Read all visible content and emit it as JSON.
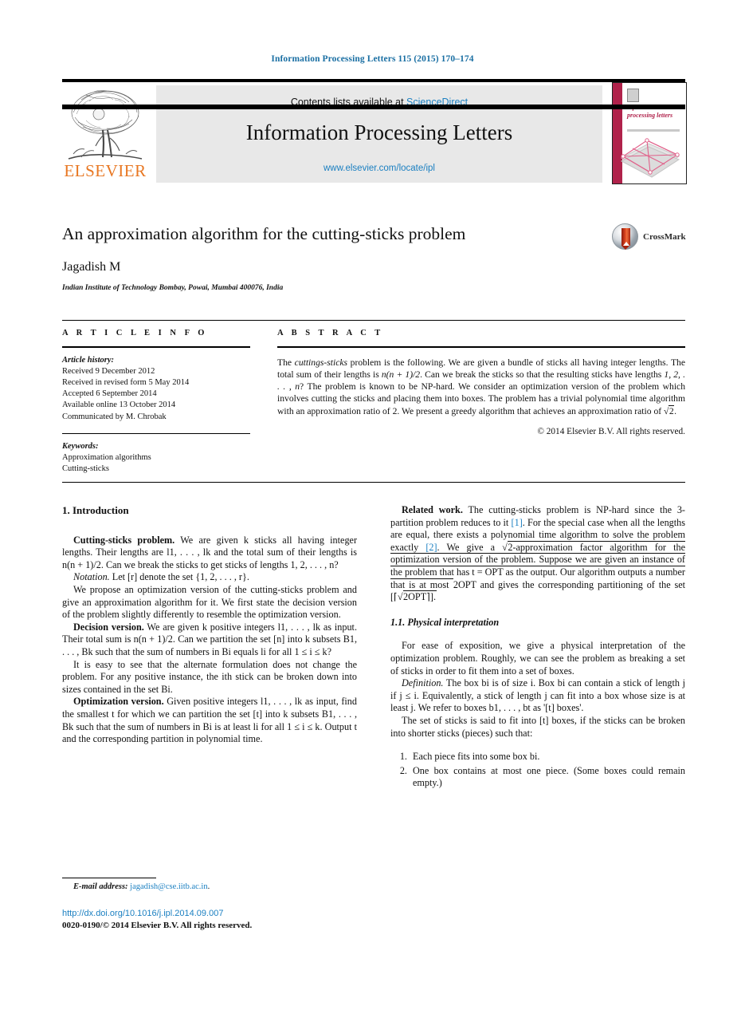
{
  "running_head": "Information Processing Letters 115 (2015) 170–174",
  "masthead": {
    "contents_prefix": "Contents lists available at ",
    "sciencedirect": "ScienceDirect",
    "journal_title": "Information Processing Letters",
    "journal_url": "www.elsevier.com/locate/ipl",
    "publisher_logo_text": "ELSEVIER",
    "cover_title": "information processing letters",
    "accent_color": "#1a7fc1",
    "elsevier_orange": "#E87722",
    "cover_spine_color": "#b0224b"
  },
  "title_block": {
    "title": "An approximation algorithm for the cutting-sticks problem",
    "author": "Jagadish M",
    "affiliation": "Indian Institute of Technology Bombay, Powai, Mumbai 400076, India",
    "crossmark_label": "CrossMark"
  },
  "article_info": {
    "heading": "A R T I C L E   I N F O",
    "history_label": "Article history:",
    "history": [
      "Received 9 December 2012",
      "Received in revised form 5 May 2014",
      "Accepted 6 September 2014",
      "Available online 13 October 2014",
      "Communicated by M. Chrobak"
    ],
    "keywords_label": "Keywords:",
    "keywords": [
      "Approximation algorithms",
      "Cutting-sticks"
    ]
  },
  "abstract": {
    "heading": "A B S T R A C T",
    "p1_a": "The ",
    "p1_italic": "cuttings-sticks",
    "p1_b": " problem is the following. We are given a bundle of sticks all having integer lengths. The total sum of their lengths is ",
    "p1_math1": "n(n + 1)/2",
    "p1_c": ". Can we break the sticks so that the resulting sticks have lengths ",
    "p1_math2": "1, 2, . . . , n",
    "p1_d": "? The problem is known to be NP-hard. We consider an optimization version of the problem which involves cutting the sticks and placing them into boxes. The problem has a trivial polynomial time algorithm with an approximation ratio of 2. We present a greedy algorithm that achieves an approximation ratio of ",
    "p1_math3": "2",
    "p1_e": ".",
    "copyright": "© 2014 Elsevier B.V. All rights reserved."
  },
  "left_column": {
    "section_heading": "1. Introduction",
    "p1_runin": "Cutting-sticks problem.",
    "p1_text": " We are given k sticks all having integer lengths. Their lengths are l1, . . . , lk and the total sum of their lengths is n(n + 1)/2. Can we break the sticks to get sticks of lengths 1, 2, . . . , n?",
    "p2_runin": "Notation.",
    "p2_text": " Let [r] denote the set {1, 2, . . . , r}.",
    "p3_text": "We propose an optimization version of the cutting-sticks problem and give an approximation algorithm for it. We first state the decision version of the problem slightly differently to resemble the optimization version.",
    "p4_runin": "Decision version.",
    "p4_text": " We are given k positive integers l1, . . . , lk as input. Their total sum is n(n + 1)/2. Can we partition the set [n] into k subsets B1, . . . , Bk such that the sum of numbers in Bi equals li for all 1 ≤ i ≤ k?",
    "p5_text": "It is easy to see that the alternate formulation does not change the problem. For any positive instance, the ith stick can be broken down into sizes contained in the set Bi.",
    "p6_runin": "Optimization version.",
    "p6_text": " Given positive integers l1, . . . , lk as input, find the smallest t for which we can partition the set [t] into k subsets B1, . . . , Bk such that the sum of numbers in Bi is at least li for all 1 ≤ i ≤ k. Output t and the corresponding partition in polynomial time."
  },
  "right_column": {
    "p1_runin": "Related work.",
    "p1_text": " The cutting-sticks problem is NP-hard since the 3-partition problem reduces to it ",
    "p1_ref1": "[1]",
    "p1_text2": ". For the special case when all the lengths are equal, there exists a polynomial time algorithm to solve the problem exactly ",
    "p1_ref2": "[2]",
    "p1_text3": ". We give a ",
    "p1_text4": "2-approximation factor algorithm for the optimization version of the problem. Suppose we are given an instance of the problem that has t = OPT as the output. Our algorithm outputs a number that is at most ",
    "p1_text5": "2OPT and gives the corresponding partitioning of the set ",
    "p1_text6": "[⌈",
    "p1_text7": "2OPT⌉].",
    "subsection_heading": "1.1. Physical interpretation",
    "p2_text": "For ease of exposition, we give a physical interpretation of the optimization problem. Roughly, we can see the problem as breaking a set of sticks in order to fit them into a set of boxes.",
    "p3_runin": "Definition.",
    "p3_text": " The box bi is of size i. Box bi can contain a stick of length j if j ≤ i. Equivalently, a stick of length j can fit into a box whose size is at least j. We refer to boxes b1, . . . , bt as '[t] boxes'.",
    "p4_text": "The set of sticks is said to fit into [t] boxes, if the sticks can be broken into shorter sticks (pieces) such that:",
    "list": [
      "Each piece fits into some box bi.",
      "One box contains at most one piece. (Some boxes could remain empty.)"
    ]
  },
  "footer": {
    "email_label": "E-mail address:",
    "email": "jagadish@cse.iitb.ac.in",
    "email_suffix": ".",
    "doi": "http://dx.doi.org/10.1016/j.ipl.2014.09.007",
    "issn_line": "0020-0190/© 2014 Elsevier B.V. All rights reserved."
  }
}
